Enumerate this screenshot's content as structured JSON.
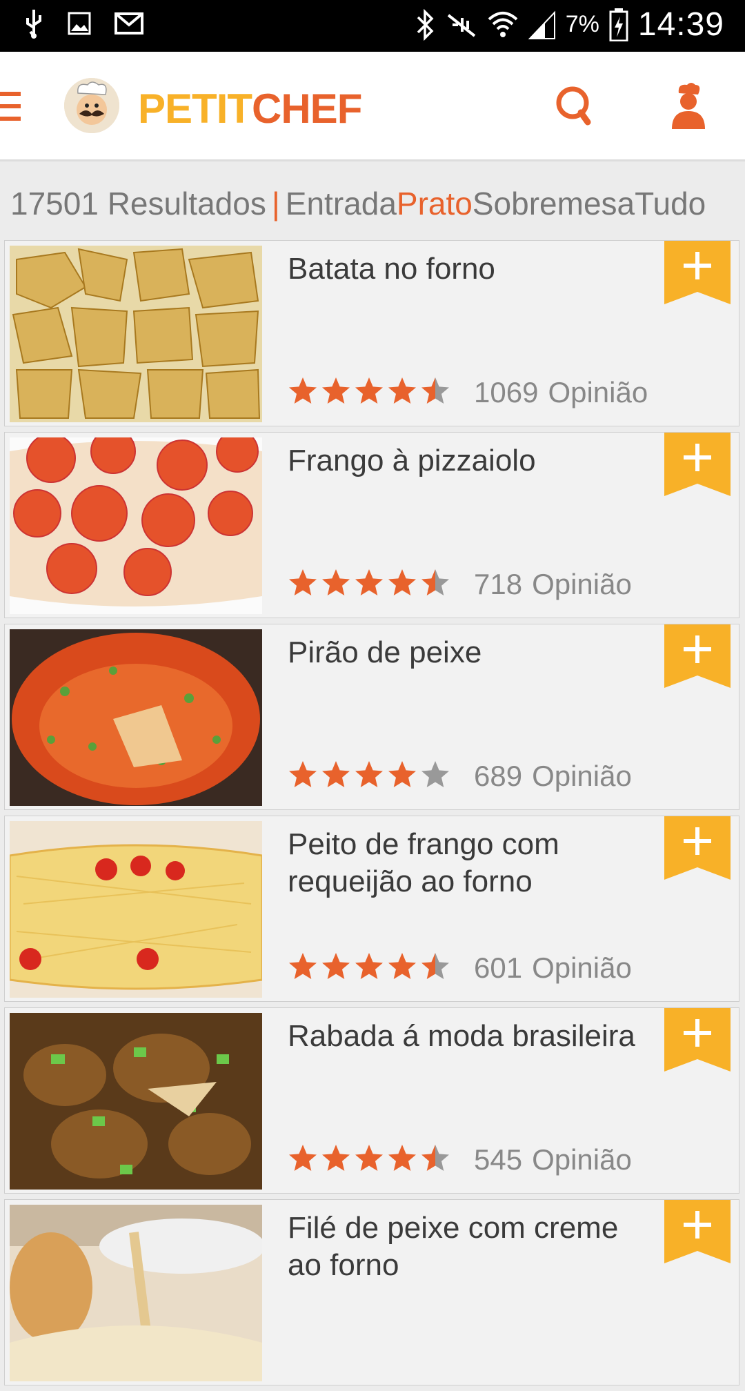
{
  "status_bar": {
    "battery": "7%",
    "time": "14:39",
    "icons": [
      "usb-icon",
      "image-icon",
      "gmail-icon",
      "bluetooth-icon",
      "mute-icon",
      "wifi-icon",
      "signal-icon",
      "battery-icon"
    ]
  },
  "app": {
    "brand_part1": "PETIT",
    "brand_part2": "CHEF",
    "accent": "#e8622c",
    "yellow": "#f8b128"
  },
  "filter": {
    "results": "17501 Resultados",
    "separator": "|",
    "tabs": [
      "Entrada",
      "Prato",
      "Sobremesa",
      "Tudo"
    ],
    "active": "Prato"
  },
  "recipes": [
    {
      "title": "Batata no forno",
      "rating": 4.5,
      "count": "1069",
      "label": "Opinião"
    },
    {
      "title": "Frango à pizzaiolo",
      "rating": 4.5,
      "count": "718",
      "label": "Opinião"
    },
    {
      "title": "Pirão de peixe",
      "rating": 4,
      "count": "689",
      "label": "Opinião"
    },
    {
      "title": "Peito de frango com requeijão ao forno",
      "rating": 4.5,
      "count": "601",
      "label": "Opinião"
    },
    {
      "title": "Rabada á moda brasileira",
      "rating": 4.5,
      "count": "545",
      "label": "Opinião"
    },
    {
      "title": "Filé de peixe com creme ao forno",
      "rating": null,
      "count": "",
      "label": ""
    }
  ]
}
